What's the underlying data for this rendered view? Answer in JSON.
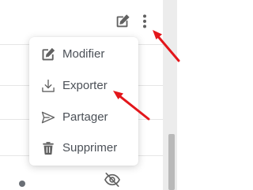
{
  "toolbar": {
    "edit_icon": "pencil-square-icon",
    "more_icon": "more-vertical-icon"
  },
  "menu": {
    "items": [
      {
        "label": "Modifier",
        "icon": "edit-icon"
      },
      {
        "label": "Exporter",
        "icon": "download-icon"
      },
      {
        "label": "Partager",
        "icon": "send-icon"
      },
      {
        "label": "Supprimer",
        "icon": "trash-icon"
      }
    ]
  },
  "background": {
    "row_icon": "eye-off-icon"
  },
  "colors": {
    "icon": "#616161",
    "menu_text": "#4b5057",
    "annotation_arrow": "#e3161b"
  }
}
